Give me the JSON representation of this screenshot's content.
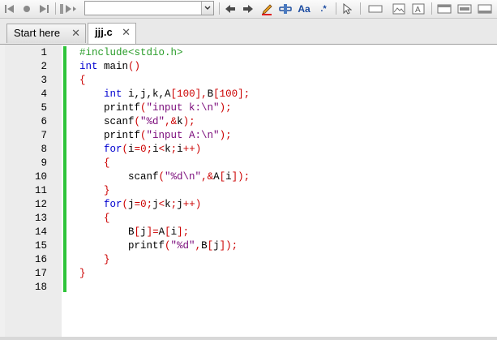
{
  "toolbar": {
    "search_value": "",
    "icons": [
      "skip-back-icon",
      "record-icon",
      "skip-forward-icon",
      "macro-run-icon",
      "search-combo",
      "arrow-left-icon",
      "arrow-right-icon",
      "pencil-icon",
      "link-icon",
      "font-icon",
      "regex-icon",
      "cursor-icon",
      "rect-icon",
      "image-icon",
      "text-box-icon",
      "layout-1-icon",
      "layout-2-icon",
      "layout-3-icon"
    ]
  },
  "tabs": [
    {
      "label": "Start here",
      "close": "✕"
    },
    {
      "label": "jjj.c",
      "close": "✕"
    }
  ],
  "colors": {
    "keyword": "#0000d0",
    "preprocessor": "#2a9d2a",
    "operator": "#cc0000",
    "string": "#7a0a7a",
    "change_bar": "#2ec43a"
  },
  "editor": {
    "lines": [
      {
        "n": "1"
      },
      {
        "n": "2"
      },
      {
        "n": "3"
      },
      {
        "n": "4"
      },
      {
        "n": "5"
      },
      {
        "n": "6"
      },
      {
        "n": "7"
      },
      {
        "n": "8"
      },
      {
        "n": "9"
      },
      {
        "n": "10"
      },
      {
        "n": "11"
      },
      {
        "n": "12"
      },
      {
        "n": "13"
      },
      {
        "n": "14"
      },
      {
        "n": "15"
      },
      {
        "n": "16"
      },
      {
        "n": "17"
      },
      {
        "n": "18"
      }
    ],
    "code": {
      "l1": "#include<stdio.h>",
      "l2a": "int",
      "l2b": " main",
      "l2c": "()",
      "l3": "{",
      "l4a": "int",
      "l4b": " i,j,k,A",
      "l4c": "[",
      "l4d": "100",
      "l4e": "],",
      "l4f": "B",
      "l4g": "[",
      "l4h": "100",
      "l4i": "];",
      "l5a": "printf",
      "l5b": "(",
      "l5c": "\"input k:\\n\"",
      "l5d": ");",
      "l6a": "scanf",
      "l6b": "(",
      "l6c": "\"%d\"",
      "l6d": ",&",
      "l6e": "k",
      "l6f": ");",
      "l7a": "printf",
      "l7b": "(",
      "l7c": "\"input A:\\n\"",
      "l7d": ");",
      "l8a": "for",
      "l8b": "(",
      "l8c": "i",
      "l8d": "=",
      "l8e": "0",
      "l8f": ";",
      "l8g": "i",
      "l8h": "<",
      "l8i": "k",
      "l8j": ";",
      "l8k": "i",
      "l8l": "++)",
      "l9": "{",
      "l10a": "scanf",
      "l10b": "(",
      "l10c": "\"%d\\n\"",
      "l10d": ",&",
      "l10e": "A",
      "l10f": "[",
      "l10g": "i",
      "l10h": "]);",
      "l11": "}",
      "l12a": "for",
      "l12b": "(",
      "l12c": "j",
      "l12d": "=",
      "l12e": "0",
      "l12f": ";",
      "l12g": "j",
      "l12h": "<",
      "l12i": "k",
      "l12j": ";",
      "l12k": "j",
      "l12l": "++)",
      "l13": "{",
      "l14a": "B",
      "l14b": "[",
      "l14c": "j",
      "l14d": "]=",
      "l14e": "A",
      "l14f": "[",
      "l14g": "i",
      "l14h": "];",
      "l15a": "printf",
      "l15b": "(",
      "l15c": "\"%d\"",
      "l15d": ",",
      "l15e": "B",
      "l15f": "[",
      "l15g": "j",
      "l15h": "]);",
      "l16": "}",
      "l17": "}"
    }
  }
}
